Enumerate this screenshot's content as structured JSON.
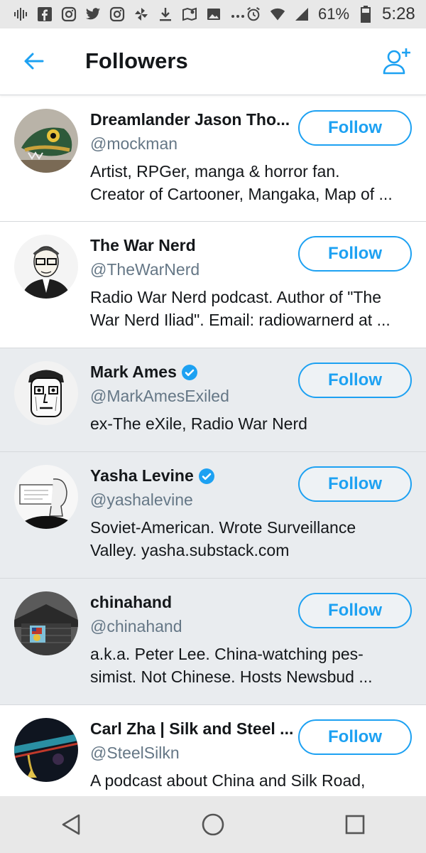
{
  "status_bar": {
    "battery_percent": "61%",
    "time": "5:28"
  },
  "header": {
    "title": "Followers"
  },
  "colors": {
    "accent": "#1da1f2",
    "text_primary": "#14171a",
    "text_secondary": "#657786",
    "row_shaded": "#e9ecef"
  },
  "followers": [
    {
      "name": "Dreamlander Jason Tho...",
      "handle": "@mockman",
      "verified": false,
      "bio_lines": [
        "Artist, RPGer, manga & horror fan.",
        "Creator of Cartooner, Mangaka, Map of ..."
      ],
      "button": "Follow",
      "avatar_icon": "creature-avatar"
    },
    {
      "name": "The War Nerd",
      "handle": "@TheWarNerd",
      "verified": false,
      "bio_lines": [
        "Radio War Nerd podcast. Author of \"The",
        "War Nerd Iliad\". Email: radiowarnerd at ..."
      ],
      "button": "Follow",
      "avatar_icon": "glasses-man-sketch-avatar"
    },
    {
      "name": "Mark Ames",
      "handle": "@MarkAmesExiled",
      "verified": true,
      "bio_lines": [
        "ex-The eXile, Radio War Nerd"
      ],
      "button": "Follow",
      "avatar_icon": "cartoon-face-avatar"
    },
    {
      "name": "Yasha Levine",
      "handle": "@yashalevine",
      "verified": true,
      "bio_lines": [
        "Soviet-American. Wrote Surveillance",
        "Valley. yasha.substack.com"
      ],
      "button": "Follow",
      "avatar_icon": "sketch-profile-avatar"
    },
    {
      "name": "chinahand",
      "handle": "@chinahand",
      "verified": false,
      "bio_lines": [
        "a.k.a. Peter Lee.  China-watching pes-",
        "simist.  Not Chinese.  Hosts Newsbud ..."
      ],
      "button": "Follow",
      "avatar_icon": "shack-flag-avatar"
    },
    {
      "name": "Carl Zha | Silk and Steel ...",
      "handle": "@SteelSilkn",
      "verified": false,
      "bio_lines": [
        "A podcast about China and Silk Road,"
      ],
      "button": "Follow",
      "avatar_icon": "tassel-avatar"
    }
  ]
}
